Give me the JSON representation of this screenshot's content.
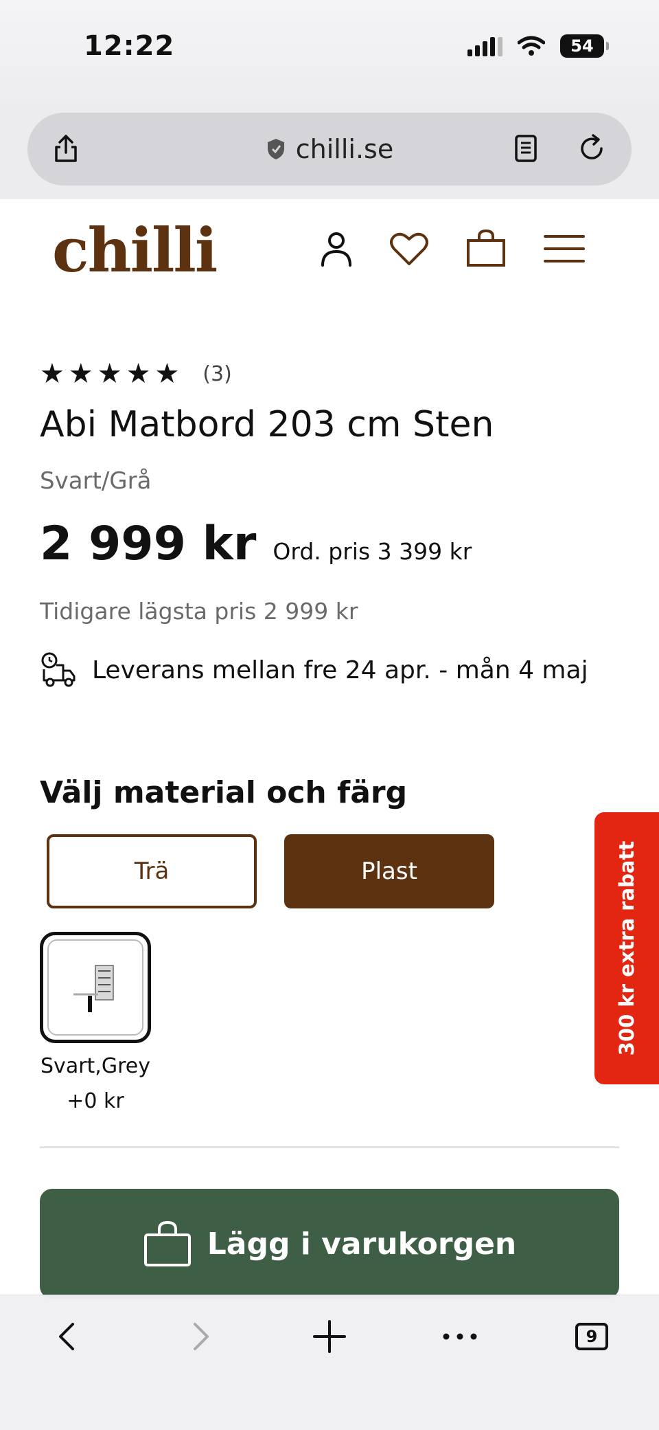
{
  "status_bar": {
    "time": "12:22",
    "battery": "54"
  },
  "browser": {
    "url": "chilli.se",
    "tabs_count": "9"
  },
  "site": {
    "logo": "chilli"
  },
  "product": {
    "rating_count": "(3)",
    "stars": 5,
    "title": "Abi Matbord 203 cm Sten",
    "variant": "Svart/Grå",
    "price": "2 999 kr",
    "ordinary_price": "Ord. pris 3 399 kr",
    "lowest_price": "Tidigare lägsta pris 2 999 kr",
    "delivery": "Leverans mellan fre 24 apr. - mån 4 maj"
  },
  "material": {
    "heading": "Välj material och färg",
    "options": [
      {
        "label": "Trä",
        "selected": false
      },
      {
        "label": "Plast",
        "selected": true
      }
    ],
    "swatch": {
      "name": "Svart,Grey",
      "price": "+0 kr"
    }
  },
  "cart": {
    "label": "Lägg i varukorgen"
  },
  "side_tab": {
    "label": "300 kr extra rabatt"
  },
  "colors": {
    "brand_brown": "#5c3211",
    "cart_green": "#3e5e46",
    "promo_red": "#e32612"
  },
  "icons": [
    "share-icon",
    "shield-icon",
    "reader-icon",
    "reload-icon",
    "account-icon",
    "heart-icon",
    "bag-icon",
    "menu-icon",
    "delivery-truck-icon",
    "back-icon",
    "forward-icon",
    "new-tab-icon",
    "more-icon",
    "tabs-icon"
  ]
}
